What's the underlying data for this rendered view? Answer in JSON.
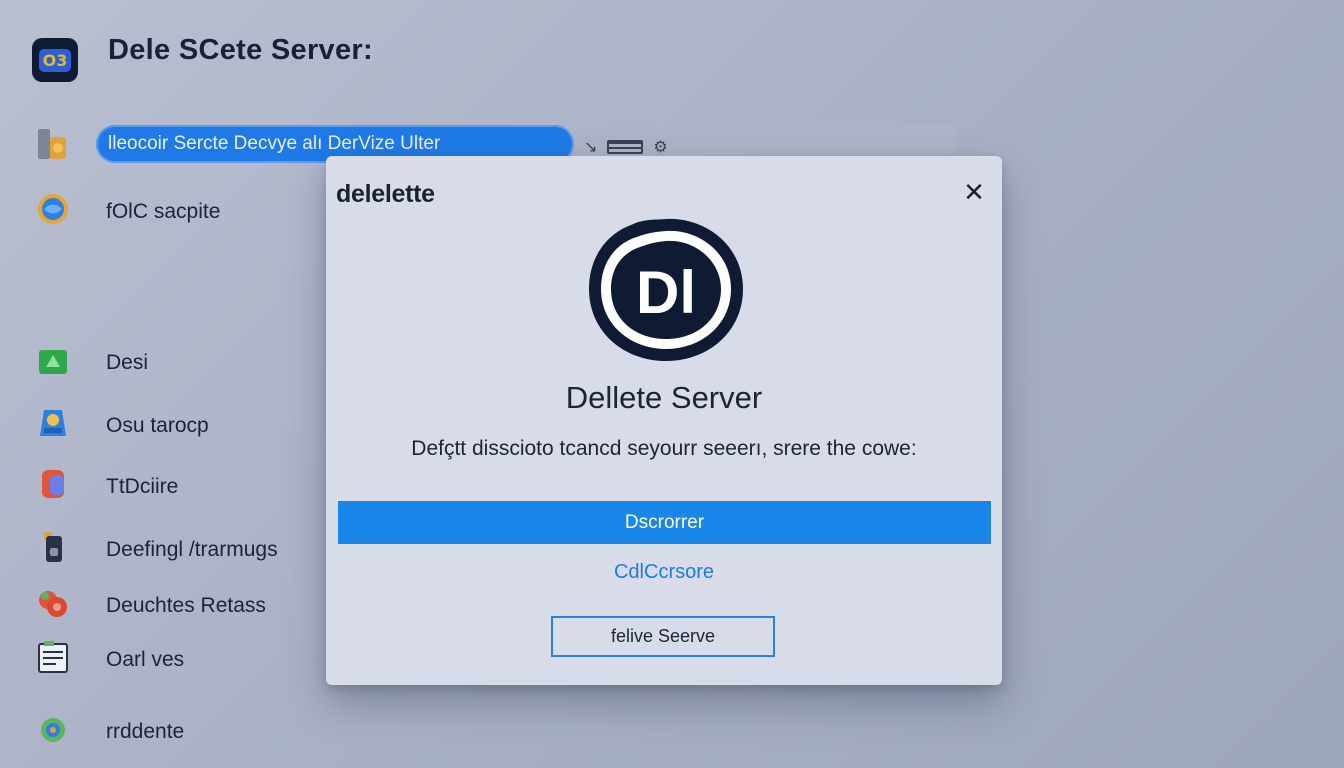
{
  "header": {
    "logo_text": "O3",
    "title": "Dele SCete  Server:"
  },
  "toolbar": {
    "search_text": "lleocoir Sercte Decvye  alı DerVize Ulter"
  },
  "sidebar": {
    "items": [
      {
        "label": "",
        "icon": "server-icon"
      },
      {
        "label": "fOlC sacpite",
        "icon": "globe-icon"
      },
      {
        "label": "Desi",
        "icon": "green-app-icon"
      },
      {
        "label": "Osu tarocp",
        "icon": "blue-app-icon"
      },
      {
        "label": "TtDciire",
        "icon": "red-app-icon"
      },
      {
        "label": "Deefingl /trarmugs",
        "icon": "device-icon"
      },
      {
        "label": "Deuchtes Retass",
        "icon": "people-icon"
      },
      {
        "label": "Oarl ves",
        "icon": "list-icon"
      },
      {
        "label": "rrddente",
        "icon": "chat-icon"
      }
    ]
  },
  "dialog": {
    "title": "delelette",
    "close_icon": "close-icon",
    "logo_text": "Dl",
    "heading": "Dellete Server",
    "message": "Defçtt disscioto tcancd seyourr seeerı, srere the cowe:",
    "primary_button": "Dscrorrer",
    "link_button": "CdlCcrsore",
    "secondary_button": "felive Seerve"
  },
  "colors": {
    "accent": "#1a86ea",
    "dialog_bg": "#d8dce8",
    "page_bg": "#aab1c5",
    "logo_dark": "#0f1a33"
  }
}
